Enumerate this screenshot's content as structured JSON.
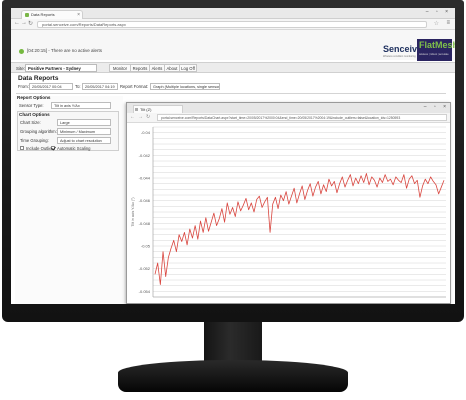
{
  "browser": {
    "tab_title": "Data Reports",
    "tab_close": "×",
    "window_controls": "– ▫ ×",
    "url": "portal.senceive.com/Reports/DataReports.aspx",
    "back": "←",
    "forward": "→",
    "refresh": "↻",
    "star": "☆",
    "menu": "≡"
  },
  "header": {
    "alert_text": "[04:20:15] - There are no active alerts",
    "brand_name": "Senceive",
    "brand_tagline": "Wireless condition monitoring",
    "product_name": "FlatMesh",
    "product_tagline": "wireless  |  robust  |  accurate"
  },
  "sitebar": {
    "site_label": "Site:",
    "site_value": "Positive Partners - Sydney",
    "menu": [
      "Monitor",
      "Reports",
      "Alerts",
      "About",
      "Log Off"
    ]
  },
  "report": {
    "title": "Data Reports",
    "from_label": "From:",
    "from_value": "20/05/2017 00:04",
    "to_label": "To:",
    "to_value": "20/05/2017 04:19",
    "format_label": "Report Format:",
    "format_value": "Graph (Multiple locations, single sensor)"
  },
  "options": {
    "report_options_title": "Report Options",
    "sensor_type_label": "Sensor Type:",
    "sensor_type_value": "Tilt in axis Y/Ax",
    "chart_options_title": "Chart Options",
    "chart_size_label": "Chart Size:",
    "chart_size_value": "Large",
    "grouping_label": "Grouping algorithm:",
    "grouping_value": "Minimum / Maximum",
    "time_grouping_label": "Time Grouping:",
    "time_grouping_value": "Adjust to chart resolution",
    "include_outliers_label": "Include Outliers",
    "include_outliers_checked": false,
    "auto_scaling_label": "Automatic Scaling",
    "auto_scaling_checked": true
  },
  "popup": {
    "tab_title": "Tilt (Z)",
    "window_controls": "– ▫ ×",
    "url": "portal.senceive.com/Reports/DataChart.aspx?start_time=20/05/2017%2000:04&end_time=20/05/2017%2004:19&include_outliers=false&location_ids=1250593"
  },
  "chart_data": {
    "type": "line",
    "ylabel": "Tilt in axis Y/Ax (°)",
    "y_ticks": [
      "-0.04",
      "-0.042",
      "-0.044",
      "-0.046",
      "-0.048",
      "-0.05",
      "-0.052",
      "-0.054"
    ],
    "ylim": [
      -0.0545,
      -0.0395
    ],
    "grid": true,
    "line_color": "#d9463f",
    "series": [
      {
        "values": [
          -0.0525,
          -0.0515,
          -0.0534,
          -0.0505,
          -0.0527,
          -0.051,
          -0.0502,
          -0.0495,
          -0.0505,
          -0.049,
          -0.0496,
          -0.0488,
          -0.0499,
          -0.0485,
          -0.0493,
          -0.0482,
          -0.0494,
          -0.0478,
          -0.0488,
          -0.0475,
          -0.0487,
          -0.0479,
          -0.0471,
          -0.0482,
          -0.0476,
          -0.0467,
          -0.0479,
          -0.0462,
          -0.0472,
          -0.0466,
          -0.0474,
          -0.0461,
          -0.0469,
          -0.0464,
          -0.0458,
          -0.0468,
          -0.0462,
          -0.047,
          -0.0459,
          -0.0456,
          -0.0466,
          -0.0461,
          -0.0457,
          -0.0488,
          -0.0463,
          -0.0457,
          -0.0467,
          -0.0455,
          -0.046,
          -0.0452,
          -0.0463,
          -0.0456,
          -0.0449,
          -0.0462,
          -0.0454,
          -0.0447,
          -0.0459,
          -0.0451,
          -0.0445,
          -0.0456,
          -0.0448,
          -0.0443,
          -0.0454,
          -0.0446,
          -0.0452,
          -0.0441,
          -0.0447,
          -0.0443,
          -0.0453,
          -0.0445,
          -0.0439,
          -0.0448,
          -0.0442,
          -0.0437,
          -0.0447,
          -0.044,
          -0.0445,
          -0.0438,
          -0.0444,
          -0.0436,
          -0.0446,
          -0.0439,
          -0.0442,
          -0.0448,
          -0.044,
          -0.0444,
          -0.0437,
          -0.0443,
          -0.0441,
          -0.0446,
          -0.0439,
          -0.0442,
          -0.0444,
          -0.0437,
          -0.0449,
          -0.0441,
          -0.0438,
          -0.0445,
          -0.0442,
          -0.0457,
          -0.0447,
          -0.0441,
          -0.0445,
          -0.0439,
          -0.0443,
          -0.0446,
          -0.0454,
          -0.0448,
          -0.0442
        ]
      }
    ]
  }
}
